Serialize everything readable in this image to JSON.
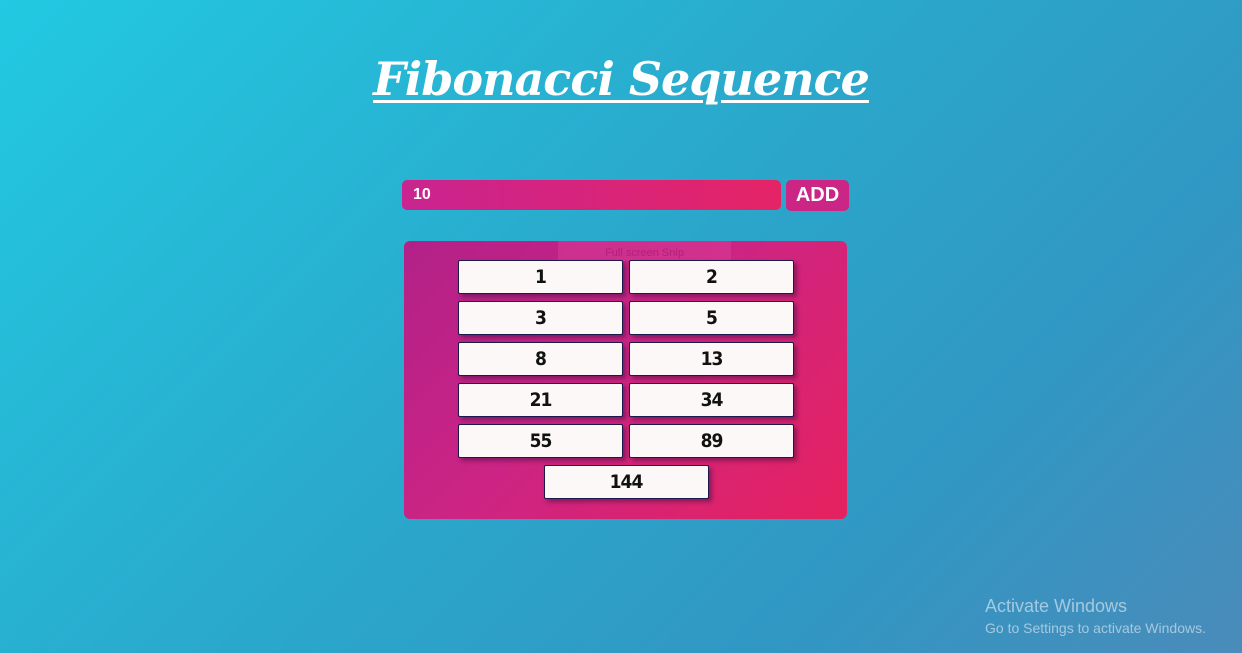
{
  "title": "Fibonacci Sequence",
  "form": {
    "input_value": "10",
    "add_label": "ADD"
  },
  "results": {
    "tooltip": "Full screen Snip",
    "numbers": [
      "1",
      "2",
      "3",
      "5",
      "8",
      "13",
      "21",
      "34",
      "55",
      "89",
      "144"
    ]
  },
  "watermark": {
    "title": "Activate Windows",
    "subtitle": "Go to Settings to activate Windows."
  },
  "colors": {
    "background_start": "#22c9e1",
    "background_end": "#4a8bba",
    "accent_pink": "#cb2586",
    "accent_red": "#e52466",
    "cell_background": "#fdf8f8"
  }
}
